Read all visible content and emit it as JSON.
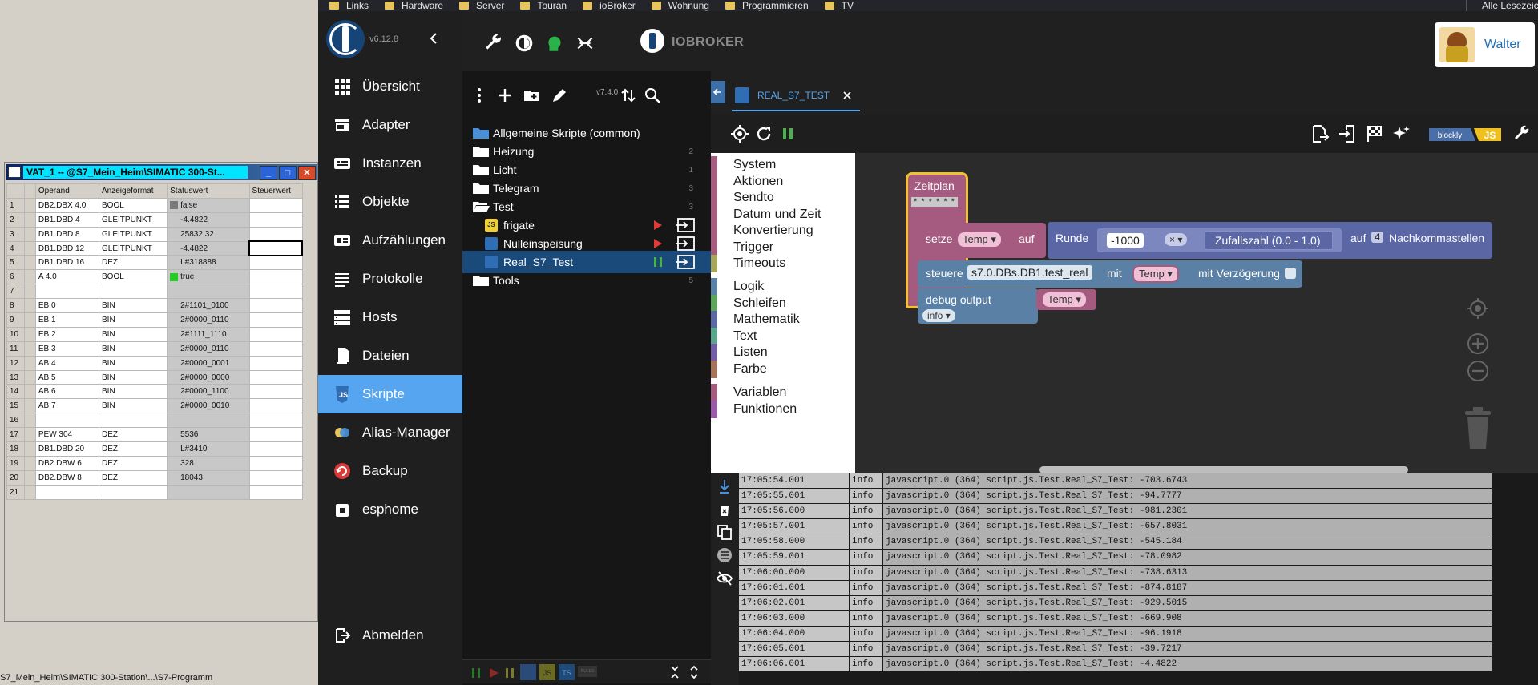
{
  "vat": {
    "title": "VAT_1 -- @S7_Mein_Heim\\SIMATIC 300-St...",
    "headers": [
      "Operand",
      "Anzeigeformat",
      "Statuswert",
      "Steuerwert"
    ],
    "rows": [
      {
        "n": "1",
        "op": "DB2.DBX 4.0",
        "fmt": "BOOL",
        "val": "false",
        "sw": "#7a7a7a"
      },
      {
        "n": "2",
        "op": "DB1.DBD 4",
        "fmt": "GLEITPUNKT",
        "val": "-4.4822",
        "sw": ""
      },
      {
        "n": "3",
        "op": "DB1.DBD 8",
        "fmt": "GLEITPUNKT",
        "val": "25832.32",
        "sw": ""
      },
      {
        "n": "4",
        "op": "DB1.DBD 12",
        "fmt": "GLEITPUNKT",
        "val": "-4.4822",
        "sw": ""
      },
      {
        "n": "5",
        "op": "DB1.DBD 16",
        "fmt": "DEZ",
        "val": "L#318888",
        "sw": ""
      },
      {
        "n": "6",
        "op": "A 4.0",
        "fmt": "BOOL",
        "val": "true",
        "sw": "#22cc22"
      },
      {
        "n": "7",
        "op": "",
        "fmt": "",
        "val": "",
        "sw": ""
      },
      {
        "n": "8",
        "op": "EB 0",
        "fmt": "BIN",
        "val": "2#1101_0100",
        "sw": ""
      },
      {
        "n": "9",
        "op": "EB 1",
        "fmt": "BIN",
        "val": "2#0000_0110",
        "sw": ""
      },
      {
        "n": "10",
        "op": "EB 2",
        "fmt": "BIN",
        "val": "2#1111_1110",
        "sw": ""
      },
      {
        "n": "11",
        "op": "EB 3",
        "fmt": "BIN",
        "val": "2#0000_0110",
        "sw": ""
      },
      {
        "n": "12",
        "op": "AB 4",
        "fmt": "BIN",
        "val": "2#0000_0001",
        "sw": ""
      },
      {
        "n": "13",
        "op": "AB 5",
        "fmt": "BIN",
        "val": "2#0000_0000",
        "sw": ""
      },
      {
        "n": "14",
        "op": "AB 6",
        "fmt": "BIN",
        "val": "2#0000_1100",
        "sw": ""
      },
      {
        "n": "15",
        "op": "AB 7",
        "fmt": "BIN",
        "val": "2#0000_0010",
        "sw": ""
      },
      {
        "n": "16",
        "op": "",
        "fmt": "",
        "val": "",
        "sw": ""
      },
      {
        "n": "17",
        "op": "PEW 304",
        "fmt": "DEZ",
        "val": "5536",
        "sw": ""
      },
      {
        "n": "18",
        "op": "DB1.DBD 20",
        "fmt": "DEZ",
        "val": "L#3410",
        "sw": ""
      },
      {
        "n": "19",
        "op": "DB2.DBW 6",
        "fmt": "DEZ",
        "val": "328",
        "sw": ""
      },
      {
        "n": "20",
        "op": "DB2.DBW 8",
        "fmt": "DEZ",
        "val": "18043",
        "sw": ""
      },
      {
        "n": "21",
        "op": "",
        "fmt": "",
        "val": "",
        "sw": ""
      }
    ],
    "status_path": "S7_Mein_Heim\\SIMATIC 300-Station\\...\\S7-Programm"
  },
  "bookmarks": [
    "Links",
    "Hardware",
    "Server",
    "Touran",
    "ioBroker",
    "Wohnung",
    "Programmieren",
    "TV"
  ],
  "bookmarks_right": "Alle Lesezeichen",
  "sidebar": {
    "version": "v6.12.8",
    "items": [
      {
        "label": "Übersicht",
        "icon": "grid-icon"
      },
      {
        "label": "Adapter",
        "icon": "store-icon"
      },
      {
        "label": "Instanzen",
        "icon": "instances-icon"
      },
      {
        "label": "Objekte",
        "icon": "list-icon"
      },
      {
        "label": "Aufzählungen",
        "icon": "enum-icon"
      },
      {
        "label": "Protokolle",
        "icon": "log-icon"
      },
      {
        "label": "Hosts",
        "icon": "hosts-icon"
      },
      {
        "label": "Dateien",
        "icon": "files-icon"
      },
      {
        "label": "Skripte",
        "icon": "scripts-icon"
      },
      {
        "label": "Alias-Manager",
        "icon": "alias-icon"
      },
      {
        "label": "Backup",
        "icon": "backup-icon"
      },
      {
        "label": "esphome",
        "icon": "esphome-icon"
      }
    ],
    "logout": "Abmelden"
  },
  "topbar": {
    "brand": "IOBROKER",
    "user": "Walter"
  },
  "tree": {
    "version": "v7.4.0",
    "items": [
      {
        "label": "Allgemeine Skripte (common)",
        "count": "",
        "kind": "folder-blue"
      },
      {
        "label": "Heizung",
        "count": "2",
        "kind": "folder"
      },
      {
        "label": "Licht",
        "count": "1",
        "kind": "folder"
      },
      {
        "label": "Telegram",
        "count": "3",
        "kind": "folder"
      },
      {
        "label": "Test",
        "count": "3",
        "kind": "folder-open"
      },
      {
        "label": "frigate",
        "count": "",
        "kind": "js"
      },
      {
        "label": "Nulleinspeisung",
        "count": "",
        "kind": "blockly"
      },
      {
        "label": "Real_S7_Test",
        "count": "",
        "kind": "blockly"
      },
      {
        "label": "Tools",
        "count": "5",
        "kind": "folder"
      }
    ]
  },
  "editor": {
    "tab": "REAL_S7_TEST",
    "mode_badge": "blockly",
    "mode_js": "JS",
    "categories": [
      {
        "label": "System",
        "color": "#a65c81"
      },
      {
        "label": "Aktionen",
        "color": "#a65c81"
      },
      {
        "label": "Sendto",
        "color": "#a65c81"
      },
      {
        "label": "Datum und Zeit",
        "color": "#a65c81"
      },
      {
        "label": "Konvertierung",
        "color": "#a65c81"
      },
      {
        "label": "Trigger",
        "color": "#a65c81"
      },
      {
        "label": "Timeouts",
        "color": "#a6a65c"
      },
      {
        "label": "Logik",
        "color": "#5c81a6"
      },
      {
        "label": "Schleifen",
        "color": "#5ca65c"
      },
      {
        "label": "Mathematik",
        "color": "#5c68a6"
      },
      {
        "label": "Text",
        "color": "#5ca68d"
      },
      {
        "label": "Listen",
        "color": "#745ca6"
      },
      {
        "label": "Farbe",
        "color": "#a6745c"
      },
      {
        "label": "Variablen",
        "color": "#a55b80"
      },
      {
        "label": "Funktionen",
        "color": "#995ba5"
      }
    ],
    "blocks": {
      "zeitplan": "Zeitplan",
      "cron": "* * * * * *",
      "setze": "setze",
      "var_temp": "Temp",
      "auf": "auf",
      "runde": "Runde",
      "num": "-1000",
      "times": "×",
      "zufall": "Zufallszahl (0.0 - 1.0)",
      "auf2": "auf",
      "decimals": "4",
      "nachkomma": "Nachkommastellen",
      "steuere": "steuere",
      "oid": "s7.0.DBs.DB1.test_real",
      "mit": "mit",
      "mit_verz": "mit Verzögerung",
      "debug": "debug output",
      "level": "info"
    }
  },
  "log": [
    {
      "time": "17:05:54.001",
      "level": "info",
      "msg": "javascript.0 (364) script.js.Test.Real_S7_Test: -703.6743"
    },
    {
      "time": "17:05:55.001",
      "level": "info",
      "msg": "javascript.0 (364) script.js.Test.Real_S7_Test: -94.7777"
    },
    {
      "time": "17:05:56.000",
      "level": "info",
      "msg": "javascript.0 (364) script.js.Test.Real_S7_Test: -981.2301"
    },
    {
      "time": "17:05:57.001",
      "level": "info",
      "msg": "javascript.0 (364) script.js.Test.Real_S7_Test: -657.8031"
    },
    {
      "time": "17:05:58.000",
      "level": "info",
      "msg": "javascript.0 (364) script.js.Test.Real_S7_Test: -545.184"
    },
    {
      "time": "17:05:59.001",
      "level": "info",
      "msg": "javascript.0 (364) script.js.Test.Real_S7_Test: -78.0982"
    },
    {
      "time": "17:06:00.000",
      "level": "info",
      "msg": "javascript.0 (364) script.js.Test.Real_S7_Test: -738.6313"
    },
    {
      "time": "17:06:01.001",
      "level": "info",
      "msg": "javascript.0 (364) script.js.Test.Real_S7_Test: -874.8187"
    },
    {
      "time": "17:06:02.001",
      "level": "info",
      "msg": "javascript.0 (364) script.js.Test.Real_S7_Test: -929.5015"
    },
    {
      "time": "17:06:03.000",
      "level": "info",
      "msg": "javascript.0 (364) script.js.Test.Real_S7_Test: -669.908"
    },
    {
      "time": "17:06:04.000",
      "level": "info",
      "msg": "javascript.0 (364) script.js.Test.Real_S7_Test: -96.1918"
    },
    {
      "time": "17:06:05.001",
      "level": "info",
      "msg": "javascript.0 (364) script.js.Test.Real_S7_Test: -39.7217"
    },
    {
      "time": "17:06:06.001",
      "level": "info",
      "msg": "javascript.0 (364) script.js.Test.Real_S7_Test: -4.4822"
    }
  ]
}
